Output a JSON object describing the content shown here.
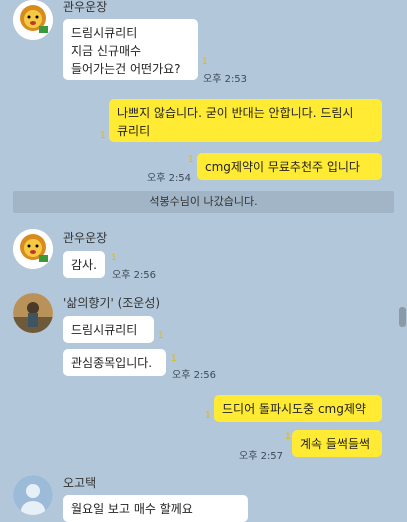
{
  "colors": {
    "background": "#b2c7d9",
    "my_bubble": "#ffeb33",
    "other_bubble": "#ffffff",
    "unread": "#e6b800"
  },
  "messages": [
    {
      "sender": "관우운장",
      "text": "드림시큐리티\n지금 신규매수\n들어가는건 어떤가요?",
      "unread": "1",
      "time": "오후 2:53"
    },
    {
      "text": "나쁘지 않습니다. 굳이 반대는 안합니다. 드림시\n큐리티",
      "unread": "1"
    },
    {
      "text": "cmg제약이 무료추천주 입니다",
      "unread": "1",
      "time": "오후 2:54"
    },
    {
      "notice": "석봉수님이 나갔습니다."
    },
    {
      "sender": "관우운장",
      "text": "감사.",
      "unread": "1",
      "time": "오후 2:56"
    },
    {
      "sender": "'삶의향기' (조운성)",
      "text": "드림시큐리티",
      "unread": "1"
    },
    {
      "text": "관심종목입니다.",
      "unread": "1",
      "time": "오후 2:56"
    },
    {
      "text": "드디어 돌파시도중 cmg제약",
      "unread": "1"
    },
    {
      "text": "계속 들썩들썩",
      "unread": "1",
      "time": "오후 2:57"
    },
    {
      "sender": "오고택",
      "text": "월요일 보고 매수 할께요"
    }
  ],
  "icons": {
    "lion": "lion-avatar-icon",
    "person": "person-photo-icon",
    "default": "default-profile-icon"
  }
}
